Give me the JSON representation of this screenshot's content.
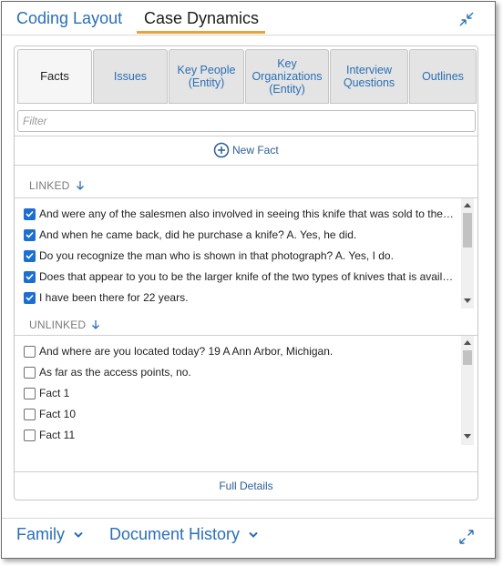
{
  "top_tabs": [
    {
      "label": "Coding Layout",
      "active": false
    },
    {
      "label": "Case Dynamics",
      "active": true
    }
  ],
  "subtabs": [
    {
      "label": "Facts",
      "active": true
    },
    {
      "label": "Issues",
      "active": false
    },
    {
      "label": "Key People (Entity)",
      "active": false
    },
    {
      "label": "Key Organizations (Entity)",
      "active": false
    },
    {
      "label": "Interview Questions",
      "active": false
    },
    {
      "label": "Outlines",
      "active": false
    }
  ],
  "filter": {
    "placeholder": "Filter",
    "value": ""
  },
  "new_fact": {
    "label": "New Fact",
    "icon": "plus-circle-icon"
  },
  "linked": {
    "label": "LINKED",
    "sort_icon": "arrow-down-icon",
    "items": [
      {
        "text": "And were any of the salesmen also involved in seeing this knife that was sold to the man who is",
        "checked": true
      },
      {
        "text": "And when he came back, did he purchase a knife?   A. Yes, he did.",
        "checked": true
      },
      {
        "text": "Do you recognize the man who is shown in that photograph?   A. Yes, I do.",
        "checked": true
      },
      {
        "text": "Does that appear to you to be the larger knife of the two types of knives that is available in your store?",
        "checked": true
      },
      {
        "text": "I have been there for 22 years.",
        "checked": true
      }
    ]
  },
  "unlinked": {
    "label": "UNLINKED",
    "sort_icon": "arrow-down-icon",
    "items": [
      {
        "text": "And where are you located today? 19   A Ann Arbor, Michigan.",
        "checked": false
      },
      {
        "text": "As far as the access points, no.",
        "checked": false
      },
      {
        "text": "Fact 1",
        "checked": false
      },
      {
        "text": "Fact 10",
        "checked": false
      },
      {
        "text": "Fact 11",
        "checked": false
      }
    ]
  },
  "full_details": {
    "label": "Full Details"
  },
  "bottom_tabs": [
    {
      "label": "Family"
    },
    {
      "label": "Document History"
    }
  ],
  "colors": {
    "accent": "#e8a33a",
    "link": "#2a6fb5",
    "checkbox": "#1c6fd0"
  }
}
